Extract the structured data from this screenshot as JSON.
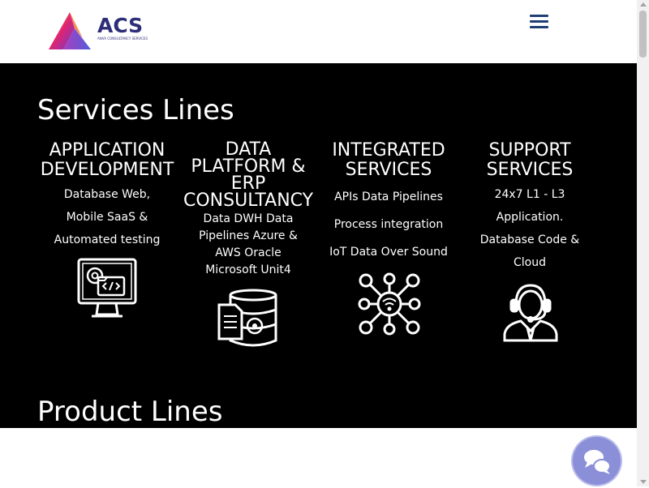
{
  "header": {
    "logo_text": "ACS",
    "logo_subtext": "ANVA CONSULTANCY SERVICES",
    "brand_colors": [
      "#f5a623",
      "#e0246f",
      "#6a3bd2",
      "#2e2e78"
    ]
  },
  "services": {
    "title": "Services Lines",
    "columns": [
      {
        "title_lines": [
          "APPLICATION",
          "DEVELOPMENT"
        ],
        "desc_lines": [
          "Database Web,",
          "Mobile SaaS &",
          "Automated testing"
        ],
        "icon": "computer-code-gear-icon"
      },
      {
        "title_lines": [
          "DATA",
          "PLATFORM &",
          "ERP",
          "CONSULTANCY"
        ],
        "desc_lines": [
          "Data DWH Data",
          "Pipelines Azure &",
          "AWS Oracle",
          "Microsoft Unit4"
        ],
        "icon": "database-document-icon"
      },
      {
        "title_lines": [
          "INTEGRATED",
          "SERVICES"
        ],
        "desc_lines": [
          "APIs Data Pipelines",
          "Process integration",
          "IoT Data Over Sound"
        ],
        "icon": "network-hub-icon"
      },
      {
        "title_lines": [
          "SUPPORT",
          "SERVICES"
        ],
        "desc_lines": [
          "24x7 L1 - L3",
          "Application.",
          "Database Code &",
          "Cloud"
        ],
        "icon": "support-agent-headset-icon"
      }
    ]
  },
  "products": {
    "title": "Product Lines"
  },
  "chat_widget": {
    "icon": "chat-bubbles-icon",
    "color": "#8a8fd8"
  }
}
